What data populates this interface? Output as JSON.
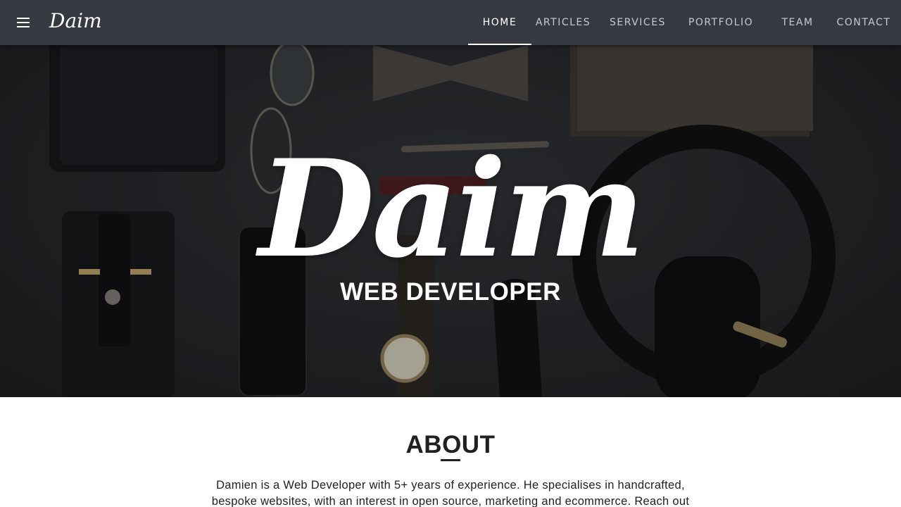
{
  "navbar": {
    "brand": "Daim",
    "links": [
      {
        "label": "HOME",
        "active": true
      },
      {
        "label": "ARTICLES",
        "active": false
      },
      {
        "label": "SERVICES",
        "active": false
      },
      {
        "label": "PORTFOLIO",
        "active": false
      },
      {
        "label": "TEAM",
        "active": false
      },
      {
        "label": "CONTACT",
        "active": false
      }
    ]
  },
  "hero": {
    "title": "Daim",
    "subtitle": "WEB DEVELOPER"
  },
  "about": {
    "heading": "ABOUT",
    "text": "Damien is a Web Developer with 5+ years of experience. He specialises in handcrafted, bespoke websites, with an interest in open source, marketing and ecommerce. Reach out"
  },
  "colors": {
    "navbar_bg": "#353a42",
    "hero_bg": "#25272a",
    "text_dark": "#212121",
    "white": "#ffffff"
  }
}
